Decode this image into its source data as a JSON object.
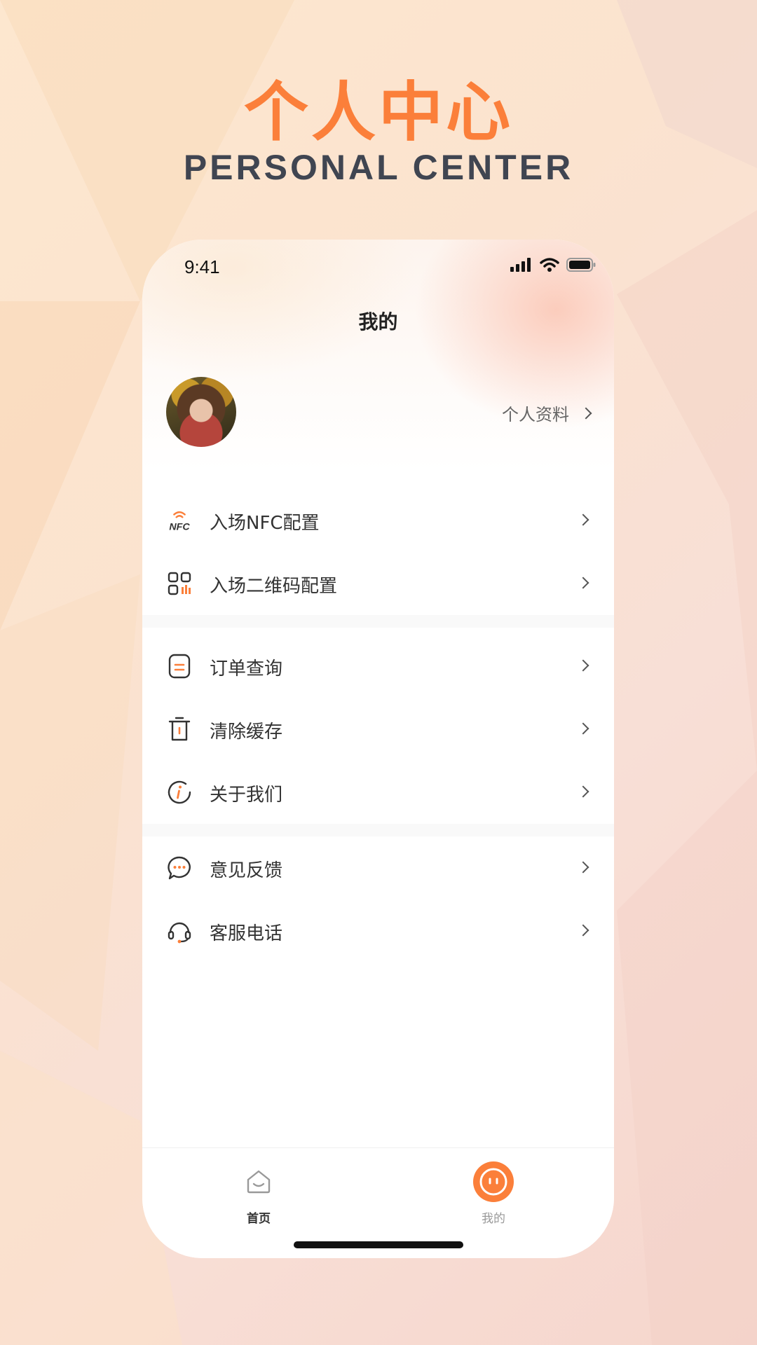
{
  "headline": {
    "title": "个人中心",
    "subtitle": "PERSONAL CENTER"
  },
  "colors": {
    "accent": "#fb7f3a",
    "headline_sub": "#404551",
    "text": "#333333",
    "muted": "#999999"
  },
  "status_bar": {
    "time": "9:41",
    "icons": [
      "signal-icon",
      "wifi-icon",
      "battery-icon"
    ]
  },
  "page": {
    "title": "我的"
  },
  "profile": {
    "link_label": "个人资料"
  },
  "menu_groups": [
    [
      {
        "label": "入场NFC配置",
        "icon": "nfc-icon"
      },
      {
        "label": "入场二维码配置",
        "icon": "qr-code-icon"
      }
    ],
    [
      {
        "label": "订单查询",
        "icon": "order-icon"
      },
      {
        "label": "清除缓存",
        "icon": "trash-icon"
      },
      {
        "label": "关于我们",
        "icon": "info-icon"
      }
    ],
    [
      {
        "label": "意见反馈",
        "icon": "chat-bubble-icon"
      },
      {
        "label": "客服电话",
        "icon": "headset-icon"
      }
    ]
  ],
  "nfc_icon_text": "NFC",
  "tab_bar": {
    "items": [
      {
        "label": "首页",
        "icon": "home-icon",
        "active": false
      },
      {
        "label": "我的",
        "icon": "face-icon",
        "active": true
      }
    ]
  }
}
